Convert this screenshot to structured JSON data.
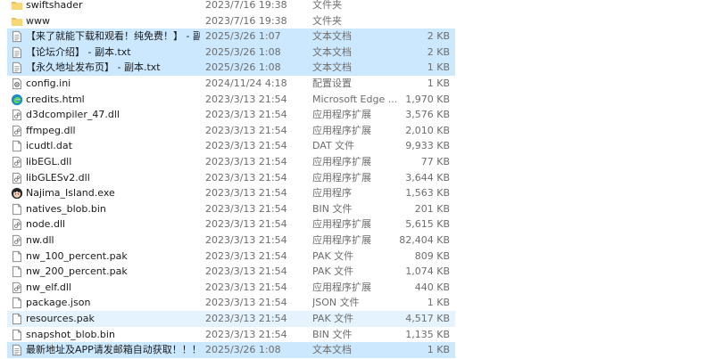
{
  "files": [
    {
      "name": "swiftshader",
      "date": "2023/7/16 19:38",
      "type": "文件夹",
      "size": "",
      "icon": "folder-icon",
      "state": ""
    },
    {
      "name": "www",
      "date": "2023/7/16 19:38",
      "type": "文件夹",
      "size": "",
      "icon": "folder-icon",
      "state": ""
    },
    {
      "name": "【来了就能下载和观看！纯免费！】 - 副本.txt",
      "date": "2025/3/26 1:07",
      "type": "文本文档",
      "size": "2 KB",
      "icon": "text-file-icon",
      "state": "selected"
    },
    {
      "name": "【论坛介绍】 - 副本.txt",
      "date": "2025/3/26 1:08",
      "type": "文本文档",
      "size": "2 KB",
      "icon": "text-file-icon",
      "state": "selected"
    },
    {
      "name": "【永久地址发布页】 - 副本.txt",
      "date": "2025/3/26 1:08",
      "type": "文本文档",
      "size": "1 KB",
      "icon": "text-file-icon",
      "state": "selected"
    },
    {
      "name": "config.ini",
      "date": "2024/11/24 4:18",
      "type": "配置设置",
      "size": "1 KB",
      "icon": "settings-file-icon",
      "state": ""
    },
    {
      "name": "credits.html",
      "date": "2023/3/13 21:54",
      "type": "Microsoft Edge ...",
      "size": "1,970 KB",
      "icon": "edge-icon",
      "state": ""
    },
    {
      "name": "d3dcompiler_47.dll",
      "date": "2023/3/13 21:54",
      "type": "应用程序扩展",
      "size": "3,576 KB",
      "icon": "dll-file-icon",
      "state": ""
    },
    {
      "name": "ffmpeg.dll",
      "date": "2023/3/13 21:54",
      "type": "应用程序扩展",
      "size": "2,010 KB",
      "icon": "dll-file-icon",
      "state": ""
    },
    {
      "name": "icudtl.dat",
      "date": "2023/3/13 21:54",
      "type": "DAT 文件",
      "size": "9,933 KB",
      "icon": "blank-file-icon",
      "state": ""
    },
    {
      "name": "libEGL.dll",
      "date": "2023/3/13 21:54",
      "type": "应用程序扩展",
      "size": "77 KB",
      "icon": "dll-file-icon",
      "state": ""
    },
    {
      "name": "libGLESv2.dll",
      "date": "2023/3/13 21:54",
      "type": "应用程序扩展",
      "size": "3,644 KB",
      "icon": "dll-file-icon",
      "state": ""
    },
    {
      "name": "Najima_Island.exe",
      "date": "2023/3/13 21:54",
      "type": "应用程序",
      "size": "1,563 KB",
      "icon": "app-icon",
      "state": ""
    },
    {
      "name": "natives_blob.bin",
      "date": "2023/3/13 21:54",
      "type": "BIN 文件",
      "size": "201 KB",
      "icon": "blank-file-icon",
      "state": ""
    },
    {
      "name": "node.dll",
      "date": "2023/3/13 21:54",
      "type": "应用程序扩展",
      "size": "5,615 KB",
      "icon": "dll-file-icon",
      "state": ""
    },
    {
      "name": "nw.dll",
      "date": "2023/3/13 21:54",
      "type": "应用程序扩展",
      "size": "82,404 KB",
      "icon": "dll-file-icon",
      "state": ""
    },
    {
      "name": "nw_100_percent.pak",
      "date": "2023/3/13 21:54",
      "type": "PAK 文件",
      "size": "809 KB",
      "icon": "blank-file-icon",
      "state": ""
    },
    {
      "name": "nw_200_percent.pak",
      "date": "2023/3/13 21:54",
      "type": "PAK 文件",
      "size": "1,074 KB",
      "icon": "blank-file-icon",
      "state": ""
    },
    {
      "name": "nw_elf.dll",
      "date": "2023/3/13 21:54",
      "type": "应用程序扩展",
      "size": "440 KB",
      "icon": "dll-file-icon",
      "state": ""
    },
    {
      "name": "package.json",
      "date": "2023/3/13 21:54",
      "type": "JSON 文件",
      "size": "1 KB",
      "icon": "blank-file-icon",
      "state": ""
    },
    {
      "name": "resources.pak",
      "date": "2023/3/13 21:54",
      "type": "PAK 文件",
      "size": "4,517 KB",
      "icon": "blank-file-icon",
      "state": "hover"
    },
    {
      "name": "snapshot_blob.bin",
      "date": "2023/3/13 21:54",
      "type": "BIN 文件",
      "size": "1,135 KB",
      "icon": "blank-file-icon",
      "state": ""
    },
    {
      "name": "最新地址及APP请发邮箱自动获取！！！",
      "date": "2025/3/26 1:08",
      "type": "文本文档",
      "size": "1 KB",
      "icon": "text-file-icon",
      "state": "selected"
    }
  ],
  "colors": {
    "selected_bg": "#cce8ff",
    "hover_bg": "#e5f3ff",
    "folder": "#f8d775",
    "edge": "#1f8ac7",
    "secondary_text": "#6d6d6d"
  }
}
